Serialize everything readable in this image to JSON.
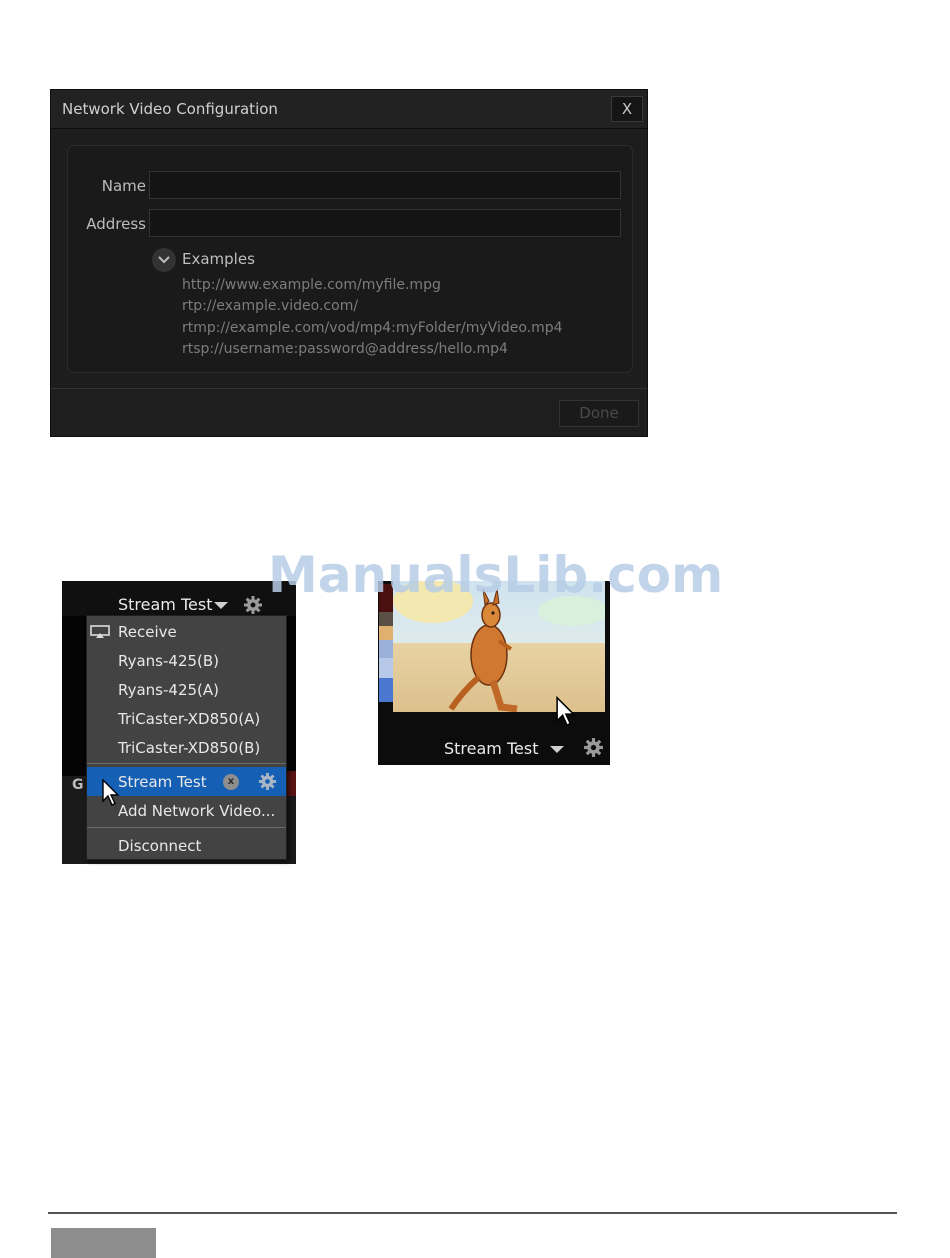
{
  "dialog": {
    "title": "Network Video Configuration",
    "close_label": "X",
    "name_label": "Name",
    "name_value": "",
    "address_label": "Address",
    "address_value": "",
    "examples_label": "Examples",
    "examples": [
      "http://www.example.com/myfile.mpg",
      "rtp://example.video.com/",
      "rtmp://example.com/vod/mp4:myFolder/myVideo.mp4",
      "rtsp://username:password@address/hello.mp4"
    ],
    "done_label": "Done"
  },
  "watermark": "ManualsLib.com",
  "left_panel": {
    "header_label": "Stream Test",
    "side_letter": "G",
    "menu": {
      "items": [
        {
          "label": "Receive",
          "icon": "airplay-icon"
        },
        {
          "label": "Ryans-425(B)"
        },
        {
          "label": "Ryans-425(A)"
        },
        {
          "label": "TriCaster-XD850(A)"
        },
        {
          "label": "TriCaster-XD850(B)"
        },
        {
          "label": "Stream Test",
          "selected": true
        },
        {
          "label": "Add Network Video..."
        },
        {
          "label": "Disconnect"
        }
      ],
      "remove_badge": "x"
    }
  },
  "right_panel": {
    "footer_label": "Stream Test"
  },
  "colors": {
    "dialog_bg": "#1d1d1d",
    "menu_bg": "#434343",
    "selected": "#1560b4",
    "watermark": "#b7cde6"
  }
}
